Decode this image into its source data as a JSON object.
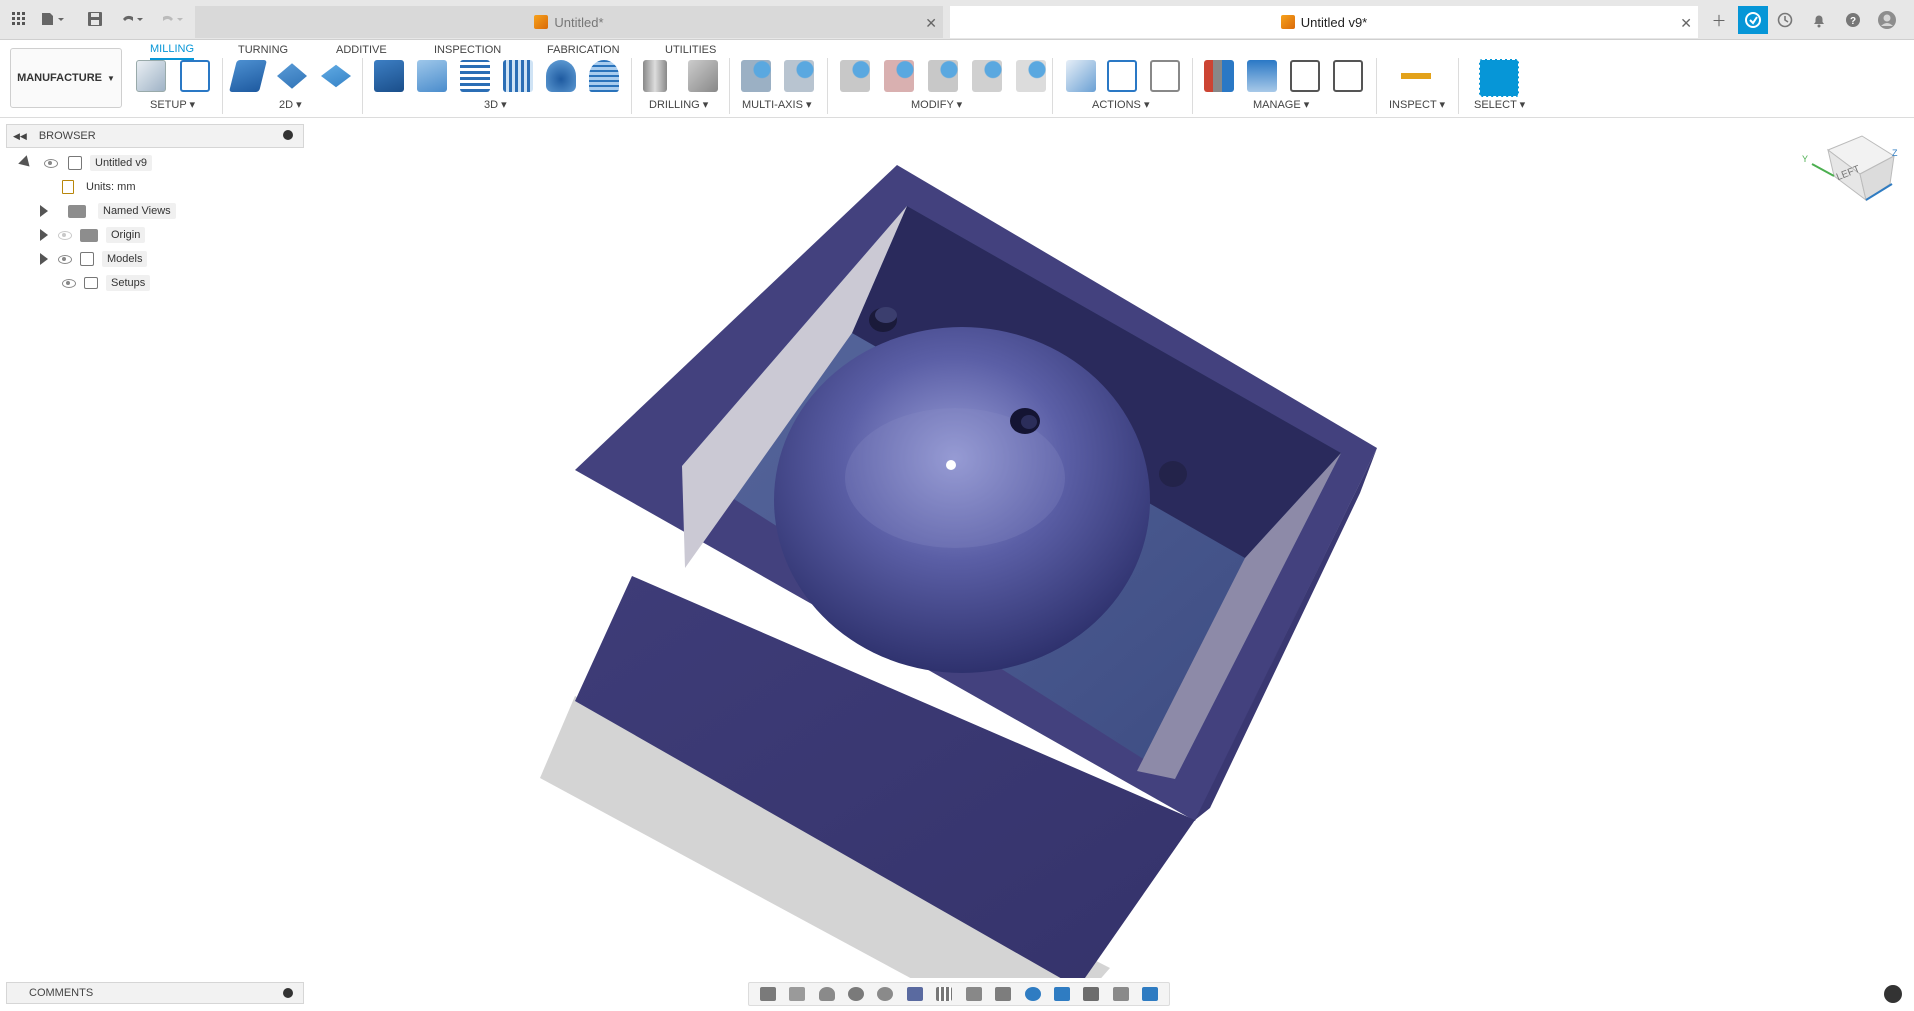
{
  "window": {
    "tabs": [
      {
        "title": "Untitled*",
        "active": false
      },
      {
        "title": "Untitled v9*",
        "active": true
      }
    ]
  },
  "ribbon": {
    "workspace": "MANUFACTURE",
    "tabs": [
      "MILLING",
      "TURNING",
      "ADDITIVE",
      "INSPECTION",
      "FABRICATION",
      "UTILITIES"
    ],
    "active_tab": "MILLING",
    "groups": [
      "SETUP",
      "2D",
      "3D",
      "DRILLING",
      "MULTI-AXIS",
      "MODIFY",
      "ACTIONS",
      "MANAGE",
      "INSPECT",
      "SELECT"
    ]
  },
  "browser": {
    "title": "BROWSER",
    "root": "Untitled v9",
    "items": [
      {
        "label": "Units: mm",
        "icon": "document-icon"
      },
      {
        "label": "Named Views",
        "icon": "folder-icon"
      },
      {
        "label": "Origin",
        "icon": "folder-icon"
      },
      {
        "label": "Models",
        "icon": "component-icon"
      },
      {
        "label": "Setups",
        "icon": "setup-icon"
      }
    ]
  },
  "viewcube": {
    "face": "LEFT",
    "axis_y": "Y",
    "axis_z": "Z"
  },
  "comments": {
    "title": "COMMENTS"
  },
  "colors": {
    "accent": "#0696d7",
    "model": "#3d3d7a",
    "active_tool": "#0696d7"
  }
}
